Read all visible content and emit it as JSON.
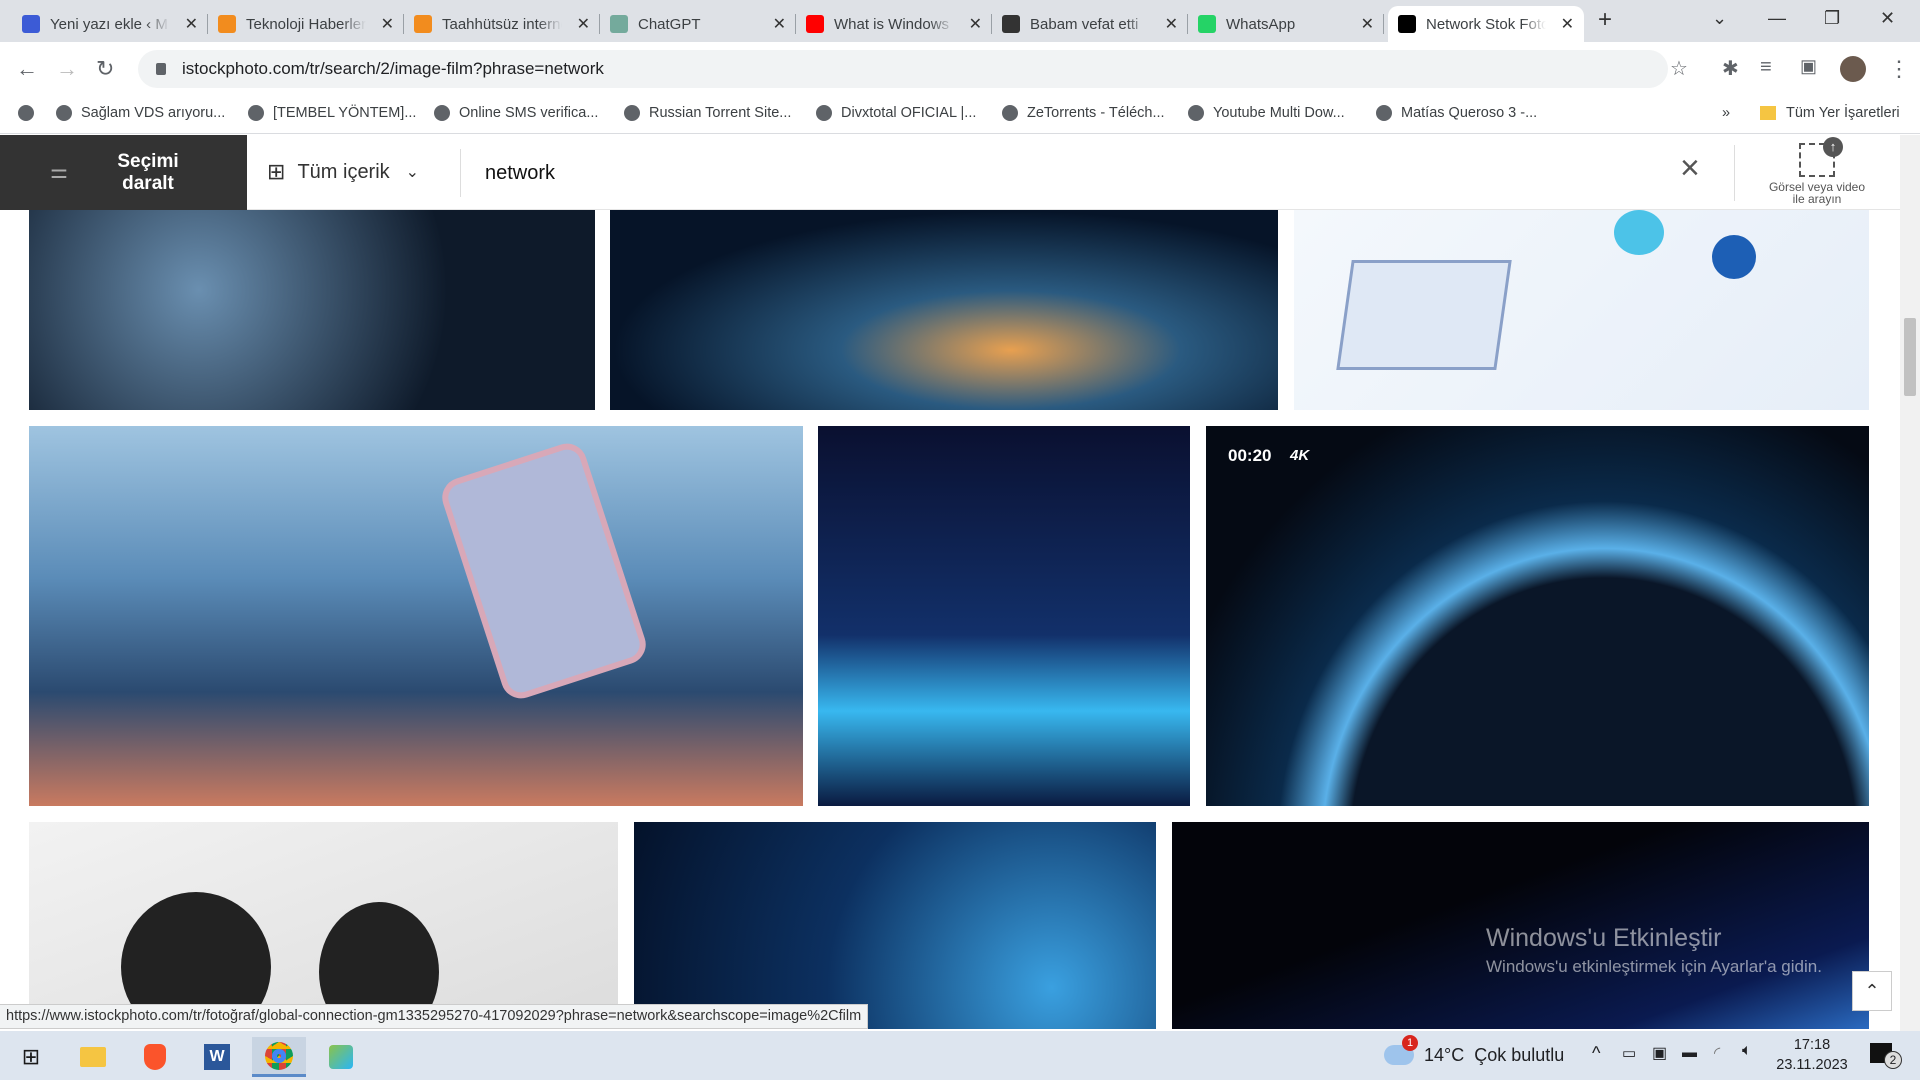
{
  "browser": {
    "tabs": [
      {
        "title": "Yeni yazı ekle ‹ M",
        "icon": "m-logo-icon",
        "color": "#3c5bd6"
      },
      {
        "title": "Teknoloji Haberleri",
        "icon": "dh-logo-icon",
        "color": "#f28c1e"
      },
      {
        "title": "Taahhütsüz internet",
        "icon": "dh-logo-icon",
        "color": "#f28c1e"
      },
      {
        "title": "ChatGPT",
        "icon": "chatgpt-icon",
        "color": "#74aa9c"
      },
      {
        "title": "What is Windows",
        "icon": "youtube-icon",
        "color": "#ff0000"
      },
      {
        "title": "Babam vefat etti",
        "icon": "forum-icon",
        "color": "#333333"
      },
      {
        "title": "WhatsApp",
        "icon": "whatsapp-icon",
        "color": "#25d366"
      },
      {
        "title": "Network Stok Fotoğraf",
        "icon": "istock-icon",
        "color": "#000000",
        "active": true
      }
    ],
    "url": "istockphoto.com/tr/search/2/image-film?phrase=network",
    "bookmarks": [
      "Sağlam VDS arıyoru...",
      "[TEMBEL YÖNTEM]...",
      "Online SMS verifica...",
      "Russian Torrent Site...",
      "Divxtotal OFICIAL |...",
      "ZeTorrents - Téléch...",
      "Youtube Multi Dow...",
      "Matías Queroso 3 -..."
    ],
    "bookmarks_more": "»",
    "all_bookmarks": "Tüm Yer İşaretleri"
  },
  "site": {
    "refine_label": "Seçimi daralt",
    "content_type": "Tüm içerik",
    "search_value": "network",
    "visual_search": "Görsel veya video ile arayın"
  },
  "results": {
    "video_badge": {
      "duration": "00:20",
      "quality": "4K"
    }
  },
  "status_url": "https://www.istockphoto.com/tr/fotoğraf/global-connection-gm1335295270-417092029?phrase=network&searchscope=image%2Cfilm",
  "watermark": {
    "title": "Windows'u Etkinleştir",
    "subtitle": "Windows'u etkinleştirmek için Ayarlar'a gidin."
  },
  "taskbar": {
    "weather_badge": "1",
    "weather": "14°C  Çok bulutlu",
    "time": "17:18",
    "date": "23.11.2023",
    "notifications": "2"
  }
}
